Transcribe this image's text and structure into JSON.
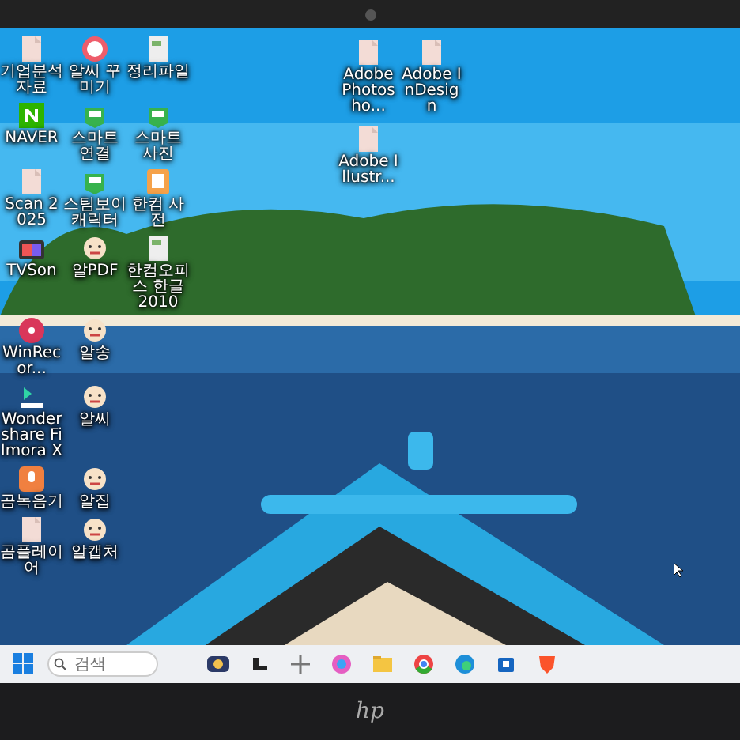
{
  "desktop_rows": [
    [
      {
        "label": "기업분석 자료",
        "kind": "doc"
      },
      {
        "label": "알씨 꾸미기",
        "kind": "cafe"
      },
      {
        "label": "정리파일",
        "kind": "file"
      }
    ],
    [
      {
        "label": "NAVER",
        "kind": "naver"
      },
      {
        "label": "스마트 연결",
        "kind": "green"
      },
      {
        "label": "스마트 사진",
        "kind": "green"
      }
    ],
    [
      {
        "label": "Scan 2025",
        "kind": "doc"
      },
      {
        "label": "스팀보이 캐릭터",
        "kind": "green"
      },
      {
        "label": "한컴 사전",
        "kind": "dict"
      }
    ],
    [
      {
        "label": "TVSon",
        "kind": "tv"
      },
      {
        "label": "알PDF",
        "kind": "mascot"
      },
      {
        "label": "한컴오피스 한글 2010",
        "kind": "file"
      }
    ],
    [
      {
        "label": "WinRecor...",
        "kind": "disc"
      },
      {
        "label": "알송",
        "kind": "mascot"
      }
    ],
    [
      {
        "label": "Wondershare Filmora X",
        "kind": "filmora"
      },
      {
        "label": "알씨",
        "kind": "mascot"
      }
    ],
    [
      {
        "label": "곰녹음기",
        "kind": "mic"
      },
      {
        "label": "알집",
        "kind": "mascot"
      }
    ],
    [
      {
        "label": "곰플레이어",
        "kind": "doc"
      },
      {
        "label": "알캡처",
        "kind": "mascot"
      }
    ]
  ],
  "right_icons": [
    {
      "label": "Adobe Photosho...",
      "kind": "doc"
    },
    {
      "label": "Adobe InDesign",
      "kind": "doc"
    },
    {
      "label": "Adobe Illustr...",
      "kind": "doc"
    }
  ],
  "taskbar": {
    "search": {
      "placeholder": "검색"
    },
    "apps": [
      {
        "kind": "widgets"
      },
      {
        "kind": "taskview"
      },
      {
        "kind": "snip"
      },
      {
        "kind": "copilot"
      },
      {
        "kind": "folder"
      },
      {
        "kind": "chrome"
      },
      {
        "kind": "edge"
      },
      {
        "kind": "store"
      },
      {
        "kind": "brave"
      }
    ]
  },
  "bezel": {
    "logo": "hp"
  }
}
